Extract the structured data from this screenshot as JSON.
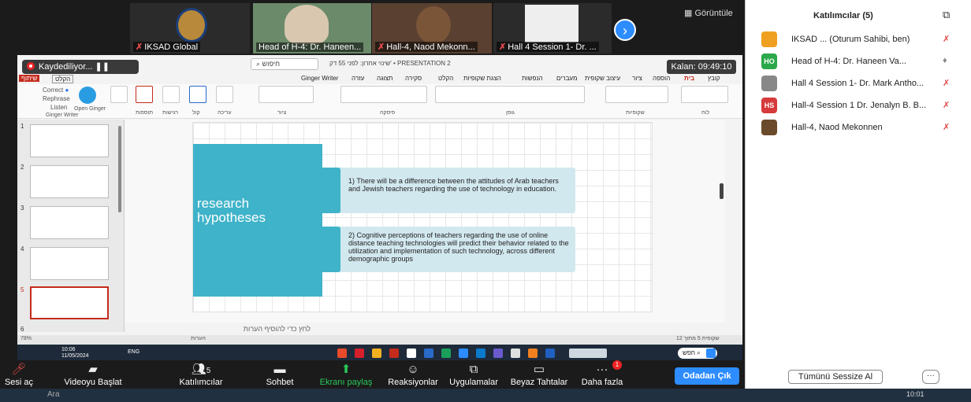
{
  "video_strip": {
    "tiles": [
      {
        "name": "IKSAD Global",
        "muted": true
      },
      {
        "name": "Head of H-4: Dr. Haneen...",
        "muted": false
      },
      {
        "name": "Hall-4, Naod Mekonn...",
        "muted": true
      },
      {
        "name": "Hall 4 Session 1- Dr. ...",
        "muted": true
      }
    ],
    "view_label": "Görüntüle",
    "next_icon": "chevron-right-icon"
  },
  "share": {
    "recording_label": "Kaydediliyor...",
    "recording_pause": "❚❚",
    "timer": "Kalan: 09:49:10",
    "search_placeholder": "חיפוש",
    "doc_title": "שינוי אחרון: לפני 55 דק' • PRESENTATION 2",
    "tabs": [
      "קובץ",
      "בית",
      "הוספה",
      "ציור",
      "עיצוב שקופית",
      "מעברים",
      "הנפשות",
      "הצגת שקופיות",
      "הקלט",
      "סקירה",
      "תצוגה",
      "עזרה",
      "Ginger Writer"
    ],
    "ribbon_labels": [
      "לוח",
      "שקופיות",
      "גופן",
      "פיסקה",
      "ציור",
      "עריכה",
      "קול",
      "רגישות",
      "תוספות",
      "Ginger Writer"
    ],
    "ginger": {
      "correct": "Correct",
      "rephrase": "Rephrase",
      "listen": "Listen",
      "open": "Open Ginger"
    },
    "share_btn": "שיתוף",
    "record_btn": "הקלט"
  },
  "slide": {
    "title_line1": "research",
    "title_line2": "hypotheses",
    "hypotheses": [
      {
        "text": "1) There will be a difference between the attitudes of Arab teachers and Jewish teachers regarding the use of technology in education.",
        "icon": "presentation-icon"
      },
      {
        "text": "2) Cognitive perceptions of teachers regarding the use of online distance teaching technologies will predict their behavior related to the utilization and implementation of such technology, across different demographic groups",
        "icon": "gear-bulb-icon"
      }
    ]
  },
  "thumbnails": [
    {
      "num": "1"
    },
    {
      "num": "2"
    },
    {
      "num": "3"
    },
    {
      "num": "4"
    },
    {
      "num": "5"
    },
    {
      "num": "6"
    }
  ],
  "notes_placeholder": "לחץ כדי להוסיף הערות",
  "statusbar": {
    "left": "הערות",
    "right": "שקופית 5 מתוך 12",
    "zoom": "78%"
  },
  "taskbar": {
    "time": "10:06",
    "date": "11/05/2024",
    "lang": "ENG",
    "search": "חפש"
  },
  "controls": [
    {
      "label": "Sesi aç",
      "icon": "mic-muted-icon"
    },
    {
      "label": "Videoyu Başlat",
      "icon": "video-off-icon"
    },
    {
      "label": "Katılımcılar",
      "icon": "participants-icon",
      "count": "5"
    },
    {
      "label": "Sohbet",
      "icon": "chat-icon"
    },
    {
      "label": "Ekranı paylaş",
      "icon": "share-screen-icon"
    },
    {
      "label": "Reaksiyonlar",
      "icon": "reaction-icon"
    },
    {
      "label": "Uygulamalar",
      "icon": "apps-icon"
    },
    {
      "label": "Beyaz Tahtalar",
      "icon": "whiteboard-icon"
    },
    {
      "label": "Daha fazla",
      "icon": "more-icon",
      "badge": "1"
    }
  ],
  "leave_label": "Odadan Çık",
  "panel": {
    "title": "Katılımcılar (5)",
    "participants": [
      {
        "name": "IKSAD ... (Oturum Sahibi, ben)",
        "initials": "",
        "color": "#f0a020"
      },
      {
        "name": "Head of H-4: Dr. Haneen Va...",
        "initials": "HO",
        "color": "#2aa84a"
      },
      {
        "name": "Hall 4 Session 1- Dr. Mark Antho...",
        "initials": "",
        "color": "#888888"
      },
      {
        "name": "Hall-4 Session 1 Dr. Jenalyn B. B...",
        "initials": "HS",
        "color": "#d63a3a"
      },
      {
        "name": "Hall-4, Naod Mekonnen",
        "initials": "",
        "color": "#6a4a2a"
      }
    ],
    "mute_all": "Tümünü Sessize Al",
    "more": "···"
  },
  "windows_bar": {
    "search": "Ara",
    "time": "10:01"
  }
}
